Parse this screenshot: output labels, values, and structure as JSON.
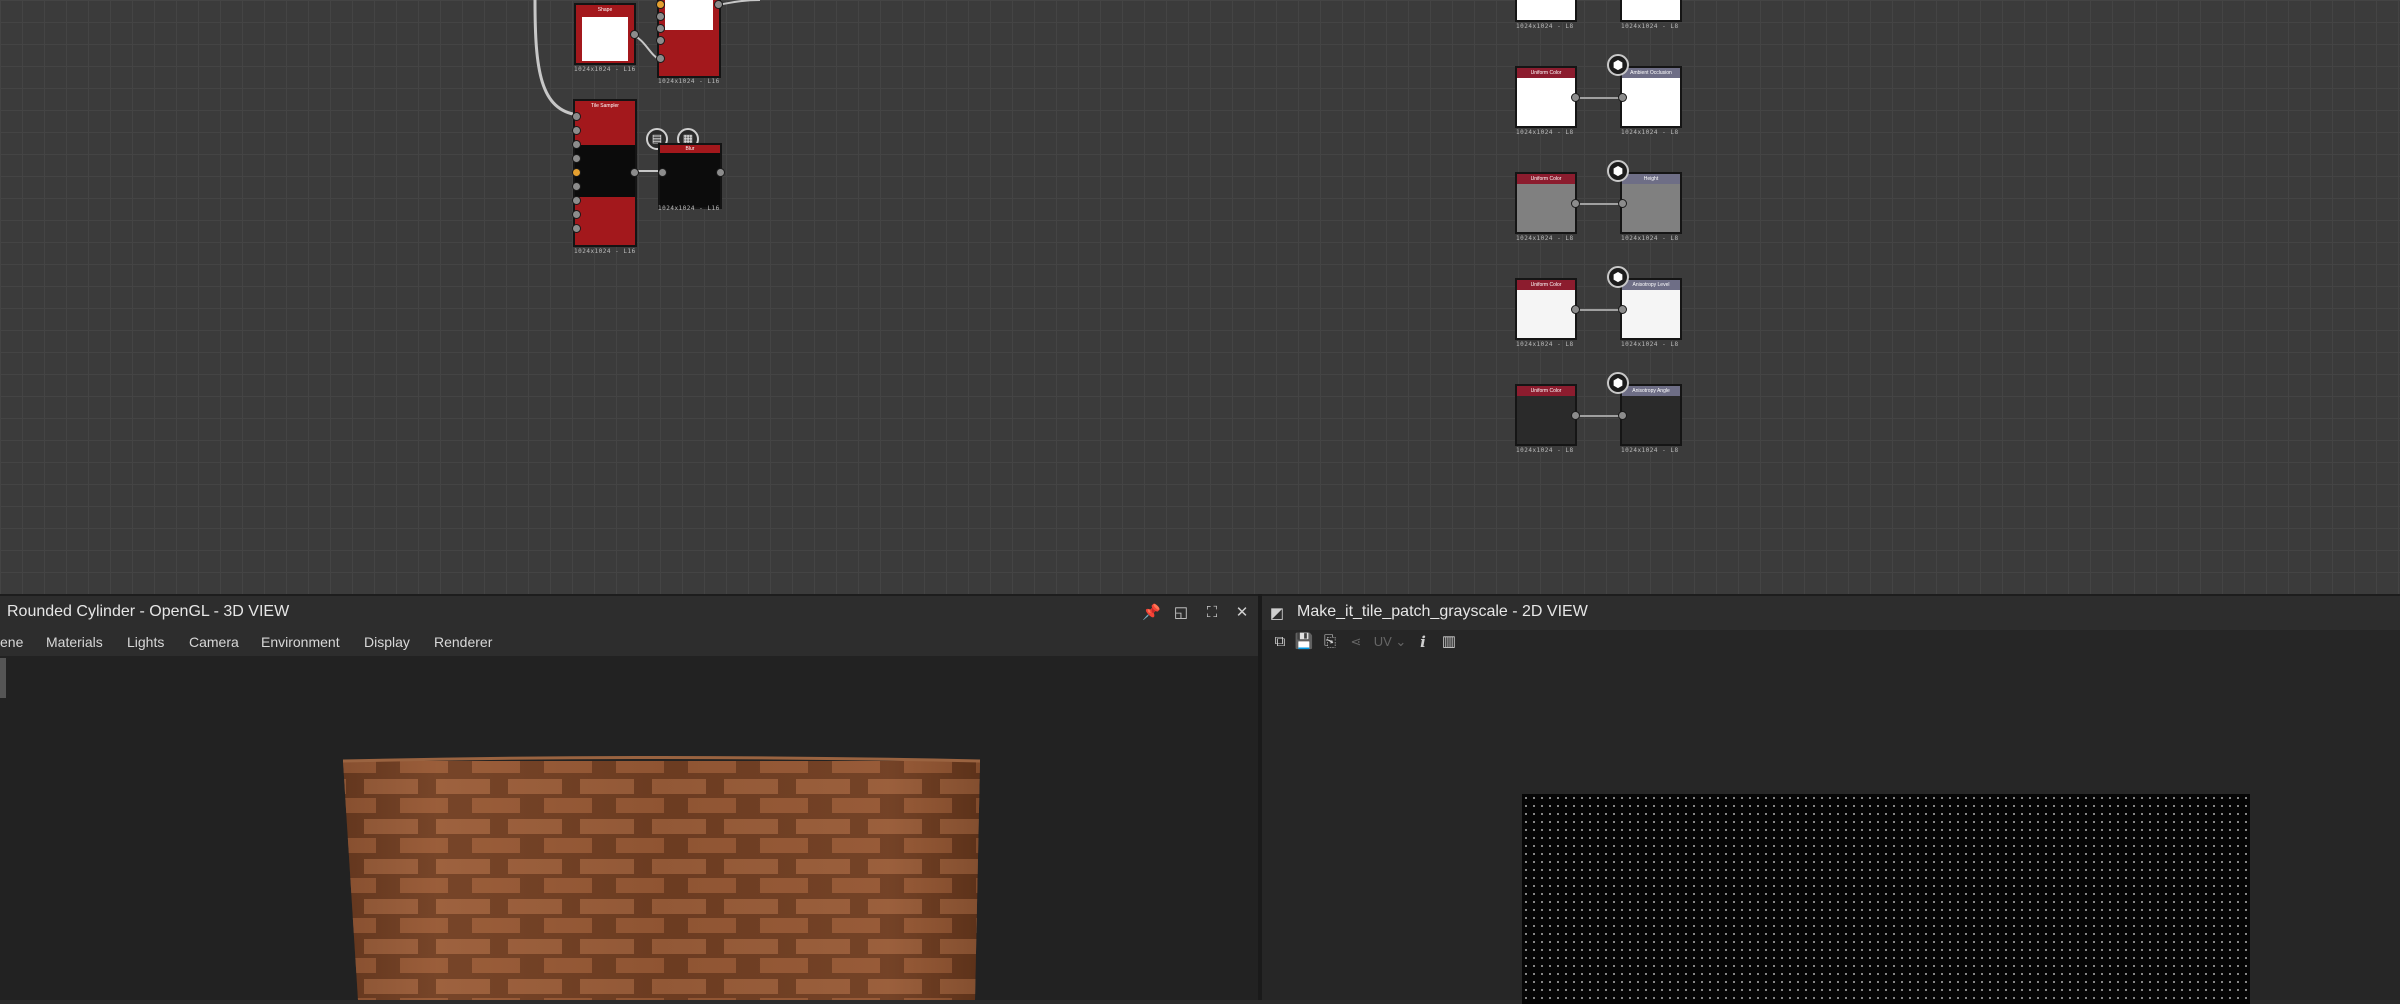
{
  "graph": {
    "nodes": {
      "shape_title": "Shape",
      "tile_sampler_title": "Tile Sampler",
      "blur_title": "Blur",
      "res_shape": "1024x1024 - L16",
      "res_top": "1024x1024 - L16",
      "res_tile": "1024x1024 - L16",
      "res_blur": "1024x1024 - L16"
    },
    "outputs": [
      {
        "uniform_title": "Uniform Color",
        "output_title": "",
        "uniform_res": "1024x1024 - L8",
        "output_res": "1024x1024 - L8",
        "color": "#ffffff"
      },
      {
        "uniform_title": "Uniform Color",
        "output_title": "Ambient Occlusion",
        "uniform_res": "1024x1024 - L8",
        "output_res": "1024x1024 - L8",
        "color": "#ffffff"
      },
      {
        "uniform_title": "Uniform Color",
        "output_title": "Height",
        "uniform_res": "1024x1024 - L8",
        "output_res": "1024x1024 - L8",
        "color": "#808080"
      },
      {
        "uniform_title": "Uniform Color",
        "output_title": "Anisotropy Level",
        "uniform_res": "1024x1024 - L8",
        "output_res": "1024x1024 - L8",
        "color": "#f5f5f5"
      },
      {
        "uniform_title": "Uniform Color",
        "output_title": "Anisotropy Angle",
        "uniform_res": "1024x1024 - L8",
        "output_res": "1024x1024 - L8",
        "color": "#2a2a2a"
      }
    ]
  },
  "panel3d": {
    "title": "Rounded Cylinder - OpenGL - 3D VIEW",
    "icons": {
      "pin": "pin-icon",
      "float": "float-icon",
      "maximize": "maximize-icon",
      "close": "close-icon"
    },
    "menu": [
      "ene",
      "Materials",
      "Lights",
      "Camera",
      "Environment",
      "Display",
      "Renderer"
    ]
  },
  "panel2d": {
    "title": "Make_it_tile_patch_grayscale - 2D VIEW",
    "toolbar": {
      "uv_label": "UV",
      "icons": [
        "view-icon",
        "save-icon",
        "copy-icon",
        "share-icon",
        "info-icon",
        "histogram-icon"
      ]
    }
  },
  "colors": {
    "graph_bg": "#3b3b3b",
    "node_red": "#a3181c",
    "panel_bg": "#262626"
  }
}
